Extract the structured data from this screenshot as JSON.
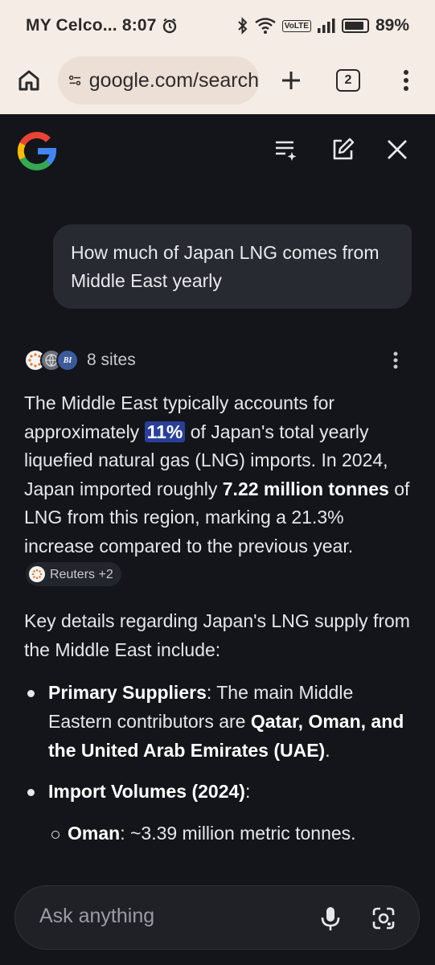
{
  "status_bar": {
    "carrier": "MY Celco...",
    "time": "8:07",
    "volte": "VoLTE",
    "battery": "89%"
  },
  "browser": {
    "url": "google.com/search",
    "tab_count": "2"
  },
  "query": "How much of Japan LNG comes from Middle East yearly",
  "sources": {
    "count_label": "8 sites",
    "favicons": [
      "reuters-icon",
      "globe-icon",
      "bi-icon"
    ],
    "bi_label": "BI"
  },
  "answer": {
    "p1_a": "The Middle East typically accounts for approximately ",
    "p1_highlight": "11%",
    "p1_b": " of Japan's total yearly liquefied natural gas (LNG) imports. In 2024, Japan imported roughly ",
    "p1_bold": "7.22 million tonnes",
    "p1_c": " of LNG from this region, marking a 21.3% increase compared to the previous year.",
    "citation_chip": "Reuters +2",
    "p2": "Key details regarding Japan's LNG supply from the Middle East include:",
    "bullets": [
      {
        "title": "Primary Suppliers",
        "text_a": ": The main Middle Eastern contributors are ",
        "text_bold": "Qatar, Oman, and the United Arab Emirates (UAE)",
        "text_b": "."
      },
      {
        "title": "Import Volumes (2024)",
        "text_a": ":"
      }
    ],
    "sub_bullets": [
      {
        "title": "Oman",
        "text": ": ~3.39 million metric tonnes."
      }
    ]
  },
  "ask_bar": {
    "placeholder": "Ask anything"
  },
  "colors": {
    "background": "#14151a",
    "chrome": "#f6ece6",
    "highlight": "#2a3f9c",
    "bubble": "#272a31"
  }
}
